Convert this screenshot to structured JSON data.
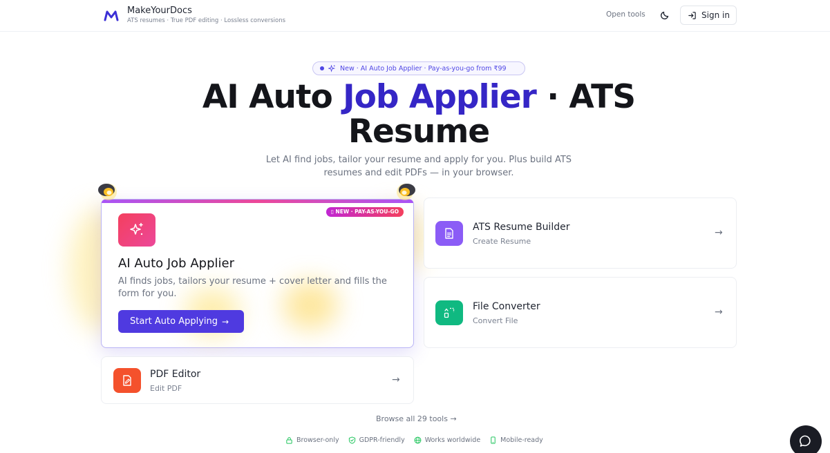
{
  "header": {
    "brand_name": "MakeYourDocs",
    "brand_tagline": "ATS resumes · True PDF editing · Lossless conversions",
    "open_tools": "Open tools",
    "sign_in": "Sign in"
  },
  "hero": {
    "pill": "New · AI Auto Job Applier · Pay-as-you-go from ₹99",
    "headline_part1": "AI Auto ",
    "headline_accent": "Job Applier",
    "headline_part2": " · ATS Resume",
    "subhead": "Let AI find jobs, tailor your resume and apply for you. Plus build ATS resumes and edit PDFs — in your browser."
  },
  "main_card": {
    "badge": "▯ NEW · PAY-AS-YOU-GO",
    "title": "AI Auto Job Applier",
    "description": "AI finds jobs, tailors your resume + cover letter and fills the form for you.",
    "cta": "Start Auto Applying",
    "cta_arrow": "→"
  },
  "tools": [
    {
      "title": "ATS Resume Builder",
      "subtitle": "Create Resume",
      "arrow": "→",
      "icon": "document-icon",
      "color": "#8b5cf6"
    },
    {
      "title": "File Converter",
      "subtitle": "Convert File",
      "arrow": "→",
      "icon": "convert-icon",
      "color": "#10b981"
    },
    {
      "title": "PDF Editor",
      "subtitle": "Edit PDF",
      "arrow": "→",
      "icon": "edit-pdf-icon",
      "color": "#f4512c"
    }
  ],
  "browse": "Browse all 29 tools →",
  "features": [
    "Browser-only",
    "GDPR-friendly",
    "Works worldwide",
    "Mobile-ready"
  ],
  "colors": {
    "brand_accent": "#4f3ae0",
    "feature_icon": "#22c55e"
  }
}
